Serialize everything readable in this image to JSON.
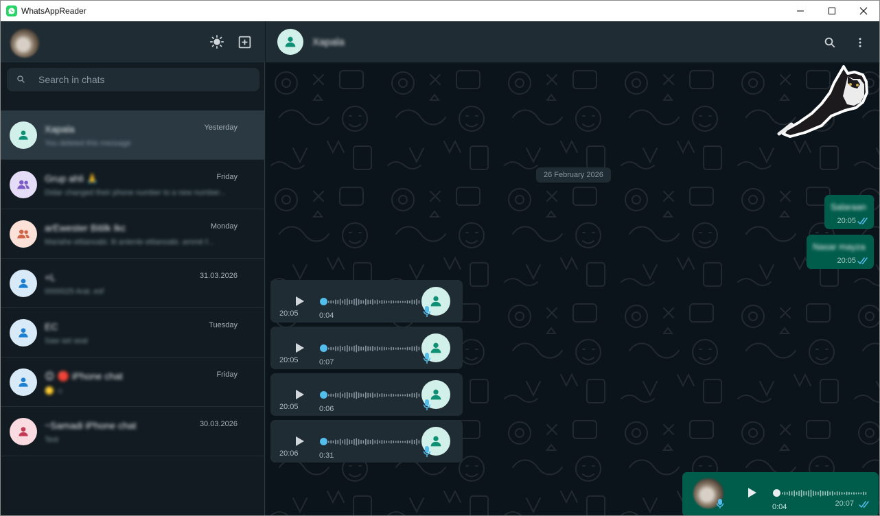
{
  "window": {
    "title": "WhatsAppReader",
    "minimize_icon": "minimize-icon",
    "maximize_icon": "maximize-icon",
    "close_icon": "close-icon"
  },
  "colors": {
    "accent": "#00a884",
    "bubble_out": "#005c4b",
    "bubble_in": "#202c33",
    "sidebar_bg": "#111b21",
    "header_bg": "#202c33",
    "tick_read": "#53bdeb"
  },
  "sidebar": {
    "theme_icon": "sun-icon",
    "new_chat_icon": "new-chat-icon",
    "search": {
      "placeholder": "Search in chats",
      "value": ""
    },
    "chats": [
      {
        "name": "Xapala",
        "preview": "You deleted this message",
        "time": "Yesterday",
        "avatar_icon": "person-icon",
        "avatar_bg": "#d1f0e9",
        "avatar_fg": "#0f8f74",
        "active": true
      },
      {
        "name": "Grup ahli 🙏",
        "preview": "Didar changed their phone number to a new number...",
        "time": "Friday",
        "avatar_icon": "group-icon",
        "avatar_bg": "#e5dcf7",
        "avatar_fg": "#7c5dc7",
        "active": false
      },
      {
        "name": "arEwester Bitilk Ikc",
        "preview": "Mariahe ettianoabi. lit antenle ettianoabi. ammé f...",
        "time": "Monday",
        "avatar_icon": "group-icon",
        "avatar_bg": "#fbe1d8",
        "avatar_fg": "#d0654a",
        "active": false
      },
      {
        "name": "+L",
        "preview": "0000025 Arat. esf",
        "time": "31.03.2026",
        "avatar_icon": "person-icon",
        "avatar_bg": "#d8eaf8",
        "avatar_fg": "#1c7fd1",
        "active": false
      },
      {
        "name": "EC",
        "preview": "Saw set seat",
        "time": "Tuesday",
        "avatar_icon": "person-icon",
        "avatar_bg": "#d8eaf8",
        "avatar_fg": "#1c7fd1",
        "active": false
      },
      {
        "name": "😊 🔴 iPhone chat",
        "preview": "🟡 ☺",
        "time": "Friday",
        "avatar_icon": "person-icon",
        "avatar_bg": "#d8eaf8",
        "avatar_fg": "#1c7fd1",
        "active": false
      },
      {
        "name": "~Samadi iPhone chat",
        "preview": "Test",
        "time": "30.03.2026",
        "avatar_icon": "person-icon",
        "avatar_bg": "#fadbe1",
        "avatar_fg": "#c33a55",
        "active": false
      }
    ]
  },
  "conversation": {
    "contact_name": "Xapala",
    "search_icon": "search-icon",
    "menu_icon": "kebab-menu-icon",
    "date_divider": "26 February 2026",
    "outgoing_texts": [
      {
        "text": "Salaraan",
        "time": "20:05",
        "status": "read"
      },
      {
        "text": "Nasar mayza",
        "time": "20:05",
        "status": "read"
      }
    ],
    "incoming_voice": [
      {
        "time": "20:05",
        "duration": "0:04",
        "progress": 0
      },
      {
        "time": "20:05",
        "duration": "0:07",
        "progress": 0
      },
      {
        "time": "20:05",
        "duration": "0:06",
        "progress": 0
      },
      {
        "time": "20:06",
        "duration": "0:31",
        "progress": 0
      }
    ],
    "outgoing_voice": {
      "time": "20:07",
      "duration": "0:04",
      "progress": 0,
      "status": "read"
    }
  }
}
